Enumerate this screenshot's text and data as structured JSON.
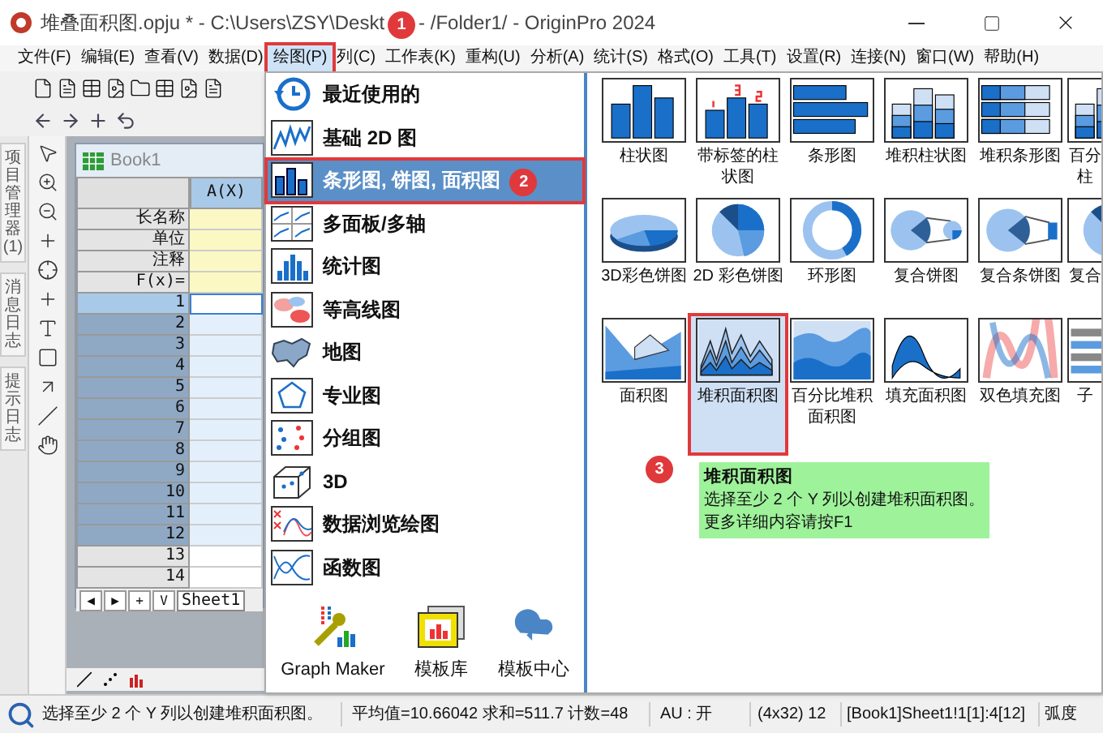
{
  "window": {
    "title_start": "堆叠面积图.opju * - C:\\Users\\ZSY\\Deskt",
    "title_end": "- /Folder1/ - OriginPro 2024",
    "callout": "1"
  },
  "menu_bar": [
    {
      "label": "文件(F)",
      "selected": false
    },
    {
      "label": "编辑(E)",
      "selected": false
    },
    {
      "label": "查看(V)",
      "selected": false
    },
    {
      "label": "数据(D)",
      "selected": false
    },
    {
      "label": "绘图(P)",
      "selected": true
    },
    {
      "label": "列(C)",
      "selected": false
    },
    {
      "label": "工作表(K)",
      "selected": false
    },
    {
      "label": "重构(U)",
      "selected": false
    },
    {
      "label": "分析(A)",
      "selected": false
    },
    {
      "label": "统计(S)",
      "selected": false
    },
    {
      "label": "格式(O)",
      "selected": false
    },
    {
      "label": "工具(T)",
      "selected": false
    },
    {
      "label": "设置(R)",
      "selected": false
    },
    {
      "label": "连接(N)",
      "selected": false
    },
    {
      "label": "窗口(W)",
      "selected": false
    },
    {
      "label": "帮助(H)",
      "selected": false
    }
  ],
  "left_tabs": [
    "项目管理器 (1)",
    "消息日志",
    "提示日志"
  ],
  "workbook": {
    "title": "Book1",
    "column_header": "A(X)",
    "label_rows": [
      "长名称",
      "单位",
      "注释",
      "F(x)="
    ],
    "rows": [
      {
        "label": "1",
        "selected": true,
        "current": true
      },
      {
        "label": "2",
        "selected": true,
        "current": false
      },
      {
        "label": "3",
        "selected": true,
        "current": false
      },
      {
        "label": "4",
        "selected": true,
        "current": false
      },
      {
        "label": "5",
        "selected": true,
        "current": false
      },
      {
        "label": "6",
        "selected": true,
        "current": false
      },
      {
        "label": "7",
        "selected": true,
        "current": false
      },
      {
        "label": "8",
        "selected": true,
        "current": false
      },
      {
        "label": "9",
        "selected": true,
        "current": false
      },
      {
        "label": "10",
        "selected": true,
        "current": false
      },
      {
        "label": "11",
        "selected": true,
        "current": false
      },
      {
        "label": "12",
        "selected": true,
        "current": false
      },
      {
        "label": "13",
        "selected": false,
        "current": false
      },
      {
        "label": "14",
        "selected": false,
        "current": false
      }
    ],
    "nav_buttons": [
      "◀",
      "▶",
      "+",
      "V"
    ],
    "sheet_tab": "Sheet1"
  },
  "plot_menu": {
    "callout": "2",
    "items": [
      {
        "label": "最近使用的",
        "kind": "recent",
        "selected": false
      },
      {
        "label": "基础 2D 图",
        "kind": "line",
        "selected": false
      },
      {
        "label": "条形图, 饼图, 面积图",
        "kind": "bar",
        "selected": true
      },
      {
        "label": "多面板/多轴",
        "kind": "multi",
        "selected": false
      },
      {
        "label": "统计图",
        "kind": "stat",
        "selected": false
      },
      {
        "label": "等高线图",
        "kind": "contour",
        "selected": false
      },
      {
        "label": "地图",
        "kind": "map",
        "selected": false
      },
      {
        "label": "专业图",
        "kind": "special",
        "selected": false
      },
      {
        "label": "分组图",
        "kind": "group",
        "selected": false
      },
      {
        "label": "3D",
        "kind": "cube",
        "selected": false
      },
      {
        "label": "数据浏览绘图",
        "kind": "browse",
        "selected": false
      },
      {
        "label": "函数图",
        "kind": "function",
        "selected": false
      }
    ],
    "bottom": [
      {
        "label": "Graph Maker",
        "kind": "maker"
      },
      {
        "label": "模板库",
        "kind": "library"
      },
      {
        "label": "模板中心",
        "kind": "cloud"
      }
    ]
  },
  "gallery": {
    "callout": "3",
    "rows": [
      [
        {
          "label": "柱状图",
          "kind": "bar",
          "selected": false
        },
        {
          "label": "带标签的柱状图",
          "kind": "labeled-bar",
          "selected": false
        },
        {
          "label": "条形图",
          "kind": "hbar",
          "selected": false
        },
        {
          "label": "堆积柱状图",
          "kind": "stacked-bar",
          "selected": false
        },
        {
          "label": "堆积条形图",
          "kind": "stacked-hbar",
          "selected": false
        },
        {
          "label": "百分柱",
          "kind": "stacked-bar",
          "selected": false
        }
      ],
      [
        {
          "label": "3D彩色饼图",
          "kind": "pie3d",
          "selected": false
        },
        {
          "label": "2D 彩色饼图",
          "kind": "pie",
          "selected": false
        },
        {
          "label": "环形图",
          "kind": "donut",
          "selected": false
        },
        {
          "label": "复合饼图",
          "kind": "pie-of-pie",
          "selected": false
        },
        {
          "label": "复合条饼图",
          "kind": "bar-of-pie",
          "selected": false
        },
        {
          "label": "复合",
          "kind": "pie",
          "selected": false
        }
      ],
      [
        {
          "label": "面积图",
          "kind": "area",
          "selected": false
        },
        {
          "label": "堆积面积图",
          "kind": "stacked-area",
          "selected": true
        },
        {
          "label": "百分比堆积面积图",
          "kind": "percent-area",
          "selected": false
        },
        {
          "label": "填充面积图",
          "kind": "fill-area",
          "selected": false
        },
        {
          "label": "双色填充图",
          "kind": "two-color",
          "selected": false
        },
        {
          "label": "子",
          "kind": "stripes",
          "selected": false
        }
      ]
    ]
  },
  "tooltip": {
    "title": "堆积面积图",
    "lines": [
      "选择至少 2 个 Y 列以创建堆积面积图。",
      "更多详细内容请按F1"
    ]
  },
  "status_bar": {
    "message": "选择至少 2 个 Y 列以创建堆积面积图。",
    "stats": "平均值=10.66042 求和=511.7 计数=48",
    "au": "AU : 开",
    "size": "(4x32) 12",
    "range": "[Book1]Sheet1!1[1]:4[12]",
    "angle": "弧度"
  }
}
